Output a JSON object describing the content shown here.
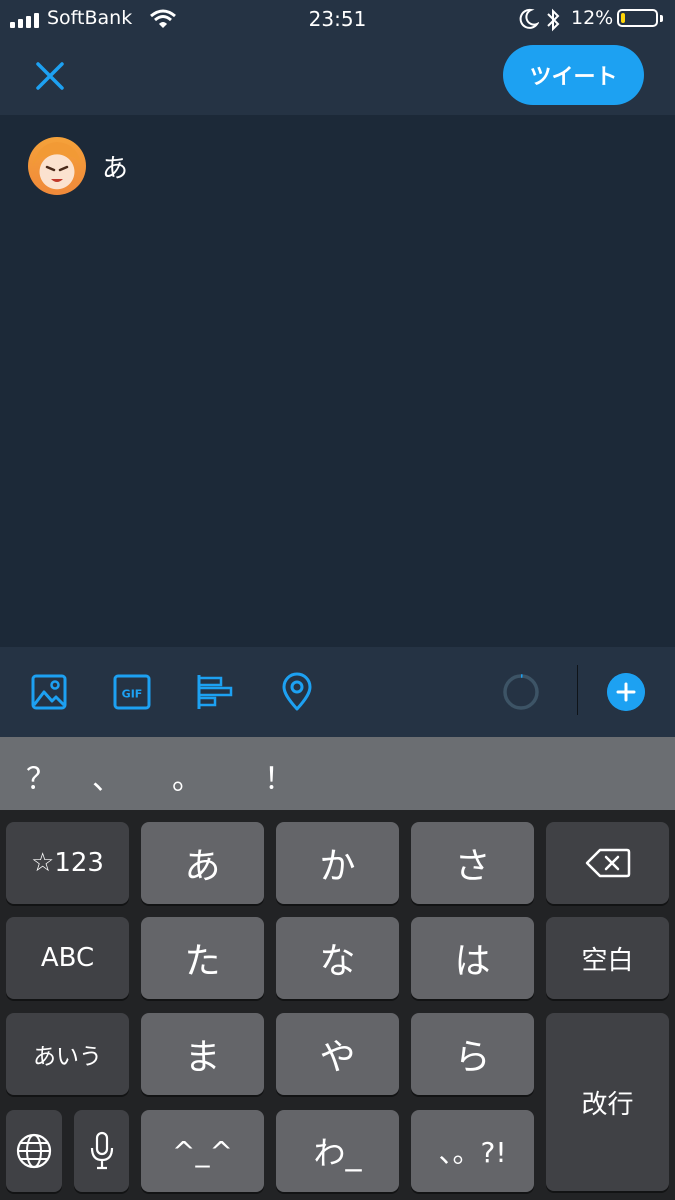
{
  "status_bar": {
    "carrier": "SoftBank",
    "time": "23:51",
    "battery_percent": "12%",
    "battery_level": 0.12,
    "icons": [
      "signal-icon",
      "wifi-icon",
      "moon-icon",
      "bluetooth-icon",
      "battery-icon"
    ]
  },
  "nav": {
    "close_icon": "close-icon",
    "tweet_label": "ツイート"
  },
  "compose": {
    "text": "あ"
  },
  "toolbar": {
    "icons": [
      "image-icon",
      "gif-icon",
      "poll-icon",
      "location-icon",
      "char-counter-icon",
      "plus-icon"
    ],
    "gif_label": "GIF"
  },
  "keyboard": {
    "candidates": [
      "？",
      "、",
      "。",
      "！"
    ],
    "row1": [
      "☆123",
      "あ",
      "か",
      "さ"
    ],
    "row2": [
      "ABC",
      "た",
      "な",
      "は",
      "空白"
    ],
    "row3": [
      "あいう",
      "ま",
      "や",
      "ら",
      "改行"
    ],
    "row4": [
      "^_^",
      "わ_",
      "、。?!"
    ]
  },
  "colors": {
    "accent": "#1da1f2",
    "background": "#1c2938",
    "bar_background": "#253344"
  }
}
